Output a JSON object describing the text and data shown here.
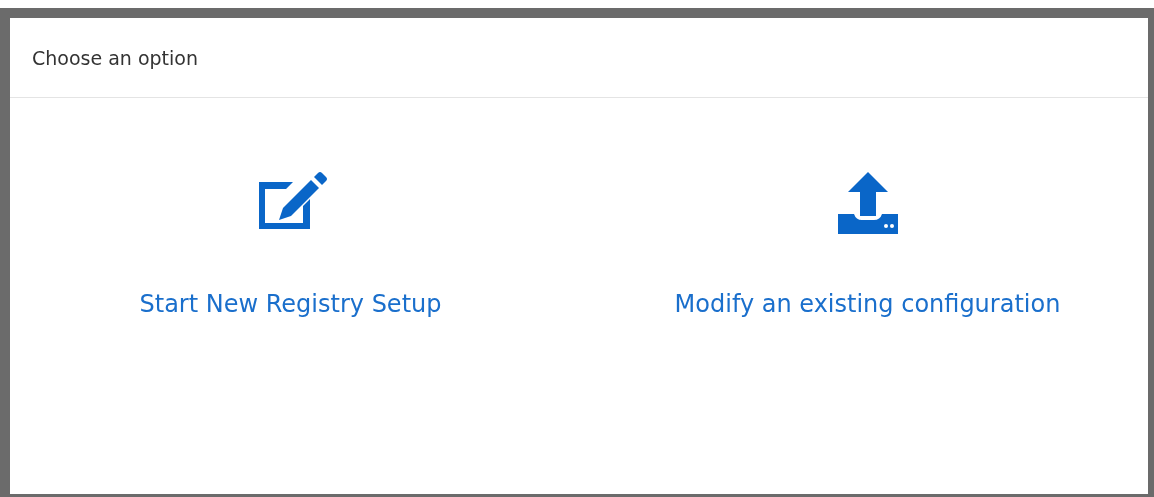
{
  "dialog": {
    "title": "Choose an option"
  },
  "options": [
    {
      "kind": "edit",
      "label": "Start New Registry Setup"
    },
    {
      "kind": "upload",
      "label": "Modify an existing configuration"
    }
  ]
}
